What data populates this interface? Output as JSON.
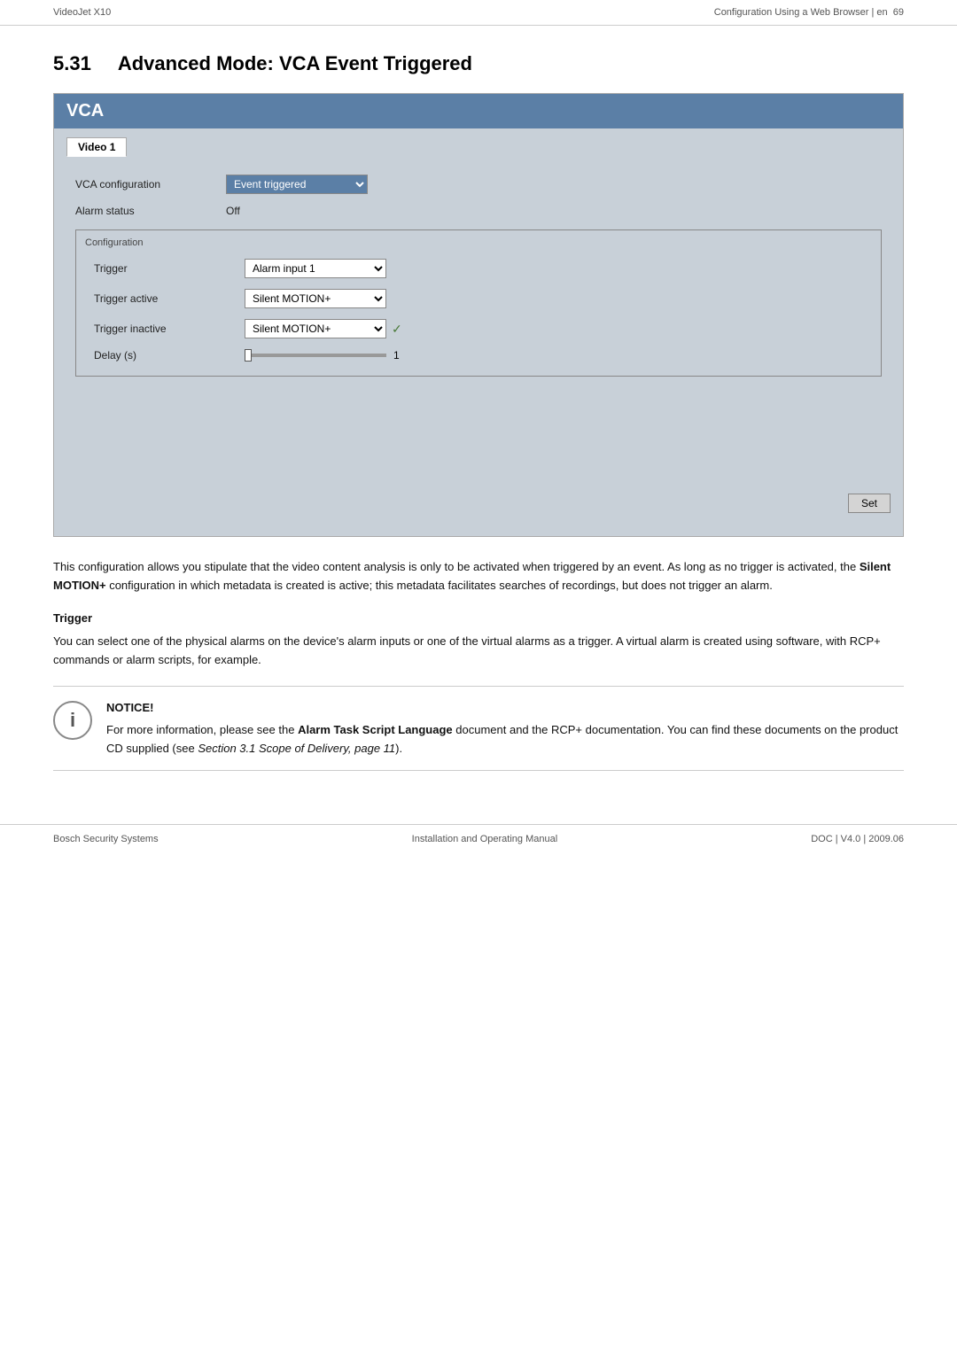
{
  "header": {
    "left": "VideoJet X10",
    "right": "Configuration Using a Web Browser | en",
    "page_number": "69"
  },
  "section": {
    "number": "5.31",
    "title": "Advanced Mode: VCA Event Triggered"
  },
  "vca_panel": {
    "title": "VCA",
    "tab_label": "Video 1",
    "vca_configuration_label": "VCA configuration",
    "vca_configuration_value": "Event triggered",
    "alarm_status_label": "Alarm status",
    "alarm_status_value": "Off",
    "configuration_group_label": "Configuration",
    "trigger_label": "Trigger",
    "trigger_value": "Alarm input 1",
    "trigger_active_label": "Trigger active",
    "trigger_active_value": "Silent MOTION+",
    "trigger_inactive_label": "Trigger inactive",
    "trigger_inactive_value": "Silent MOTION+",
    "delay_label": "Delay (s)",
    "delay_slider_value": "1",
    "set_button_label": "Set"
  },
  "description": {
    "main_text": "This configuration allows you stipulate that the video content analysis is only to be activated when triggered by an event. As long as no trigger is activated, the Silent MOTION+ configuration in which metadata is created is active; this metadata facilitates searches of recordings, but does not trigger an alarm.",
    "silent_motion_bold": "Silent MOTION+",
    "trigger_section_heading": "Trigger",
    "trigger_text": "You can select one of the physical alarms on the device's alarm inputs or one of the virtual alarms as a trigger. A virtual alarm is created using software, with RCP+ commands or alarm scripts, for example.",
    "notice_title": "NOTICE!",
    "notice_text_1": "For more information, please see the",
    "notice_bold": "Alarm Task Script Language",
    "notice_text_2": "document and the RCP+ documentation. You can find these documents on the product CD supplied (see",
    "notice_italic": "Section 3.1 Scope of Delivery, page 11",
    "notice_text_3": ")."
  },
  "footer": {
    "left": "Bosch Security Systems",
    "center": "Installation and Operating Manual",
    "right": "DOC | V4.0 | 2009.06"
  }
}
